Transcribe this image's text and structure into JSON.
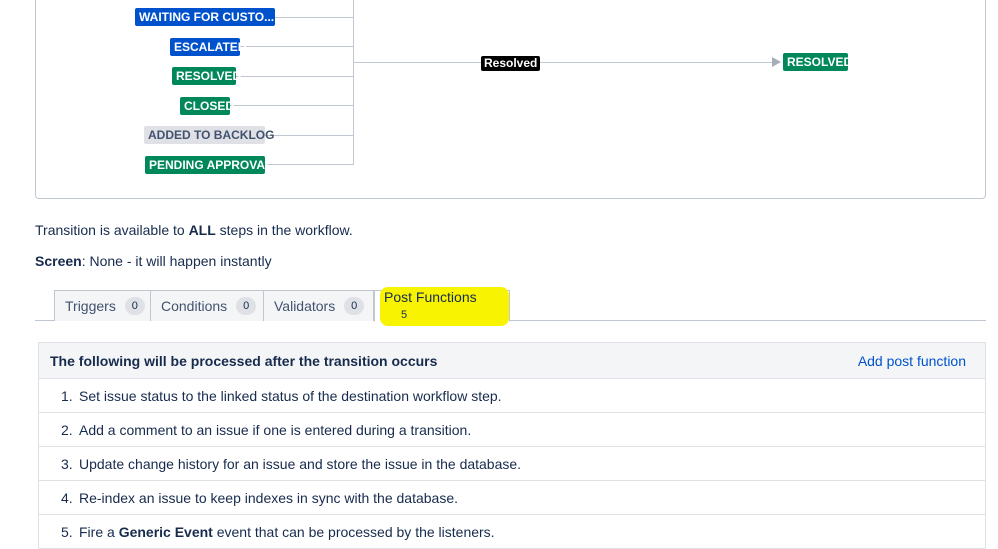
{
  "diagram": {
    "statuses": [
      {
        "label": "WAITING FOR CUSTO...",
        "color": "blue"
      },
      {
        "label": "ESCALATED",
        "color": "blue"
      },
      {
        "label": "RESOLVED",
        "color": "green"
      },
      {
        "label": "CLOSED",
        "color": "green"
      },
      {
        "label": "ADDED TO BACKLOG",
        "color": "grey"
      },
      {
        "label": "PENDING APPROVAL",
        "color": "green"
      }
    ],
    "transition_label": "Resolved",
    "destination": "RESOLVED"
  },
  "info": {
    "availability_prefix": "Transition is available to ",
    "availability_bold": "ALL",
    "availability_suffix": " steps in the workflow.",
    "screen_label": "Screen",
    "screen_value": ": None - it will happen instantly"
  },
  "tabs": [
    {
      "label": "Triggers",
      "count": "0"
    },
    {
      "label": "Conditions",
      "count": "0"
    },
    {
      "label": "Validators",
      "count": "0"
    },
    {
      "label": "Post Functions",
      "count": "5"
    }
  ],
  "post_functions": {
    "header": "The following will be processed after the transition occurs",
    "add_link": "Add post function",
    "items": [
      {
        "num": "1.",
        "text": "Set issue status to the linked status of the destination workflow step."
      },
      {
        "num": "2.",
        "text": "Add a comment to an issue if one is entered during a transition."
      },
      {
        "num": "3.",
        "text": "Update change history for an issue and store the issue in the database."
      },
      {
        "num": "4.",
        "text": "Re-index an issue to keep indexes in sync with the database."
      },
      {
        "num": "5.",
        "pre": "Fire a ",
        "bold": "Generic Event",
        "post": " event that can be processed by the listeners."
      }
    ]
  },
  "colors": {
    "blue": "#0052cc",
    "green": "#00875a",
    "grey": "#dfe1e6",
    "highlight": "#f8f300",
    "link": "#0052cc"
  }
}
